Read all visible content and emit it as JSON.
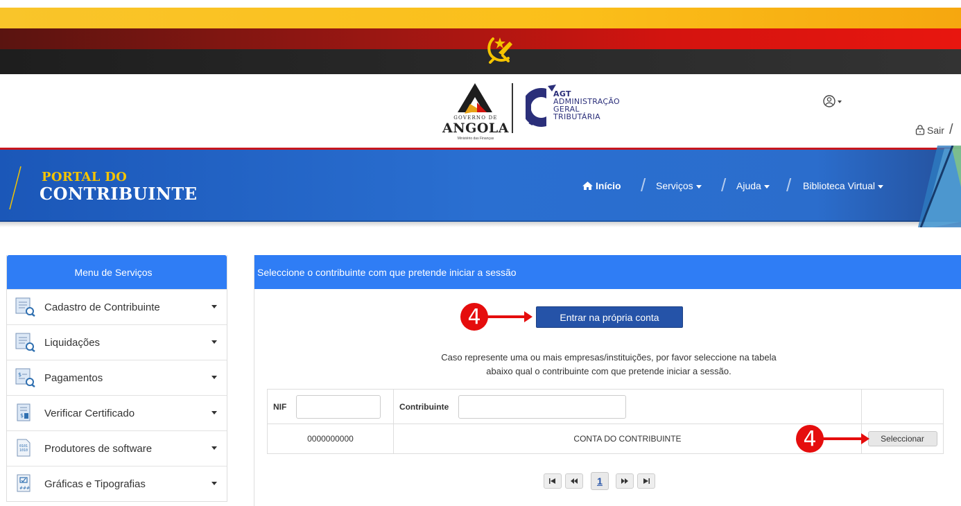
{
  "header": {
    "gov_caption": "GOVERNO DE",
    "gov_name": "ANGOLA",
    "gov_sub": "Ministério das Finanças",
    "agt_abbr": "AGT",
    "agt_line1": "ADMINISTRAÇÃO",
    "agt_line2": "GERAL",
    "agt_line3": "TRIBUTÁRIA",
    "logout_label": "Sair"
  },
  "brand": {
    "line1": "PORTAL DO",
    "line2": "CONTRIBUINTE"
  },
  "nav": {
    "home": "Início",
    "services": "Serviços",
    "help": "Ajuda",
    "library": "Biblioteca Virtual"
  },
  "sidebar": {
    "title": "Menu de Serviços",
    "items": [
      {
        "label": "Cadastro de Contribuinte"
      },
      {
        "label": "Liquidações"
      },
      {
        "label": "Pagamentos"
      },
      {
        "label": "Verificar Certificado"
      },
      {
        "label": "Produtores de software"
      },
      {
        "label": "Gráficas e Tipografias"
      }
    ]
  },
  "main": {
    "title": "Seleccione o contribuinte com que pretende iniciar a sessão",
    "enter_button": "Entrar na própria conta",
    "info_line1": "Caso represente uma ou mais empresas/instituições, por favor seleccione na tabela",
    "info_line2": "abaixo qual o contribuinte com que pretende iniciar a sessão.",
    "table": {
      "col_nif": "NIF",
      "col_contrib": "Contribuinte",
      "rows": [
        {
          "nif": "0000000000",
          "name": "CONTA DO CONTRIBUINTE",
          "action": "Seleccionar"
        }
      ]
    },
    "pager": {
      "first": "⏮",
      "prev": "⏪",
      "page": "1",
      "next": "⏩",
      "last": "⏭"
    }
  },
  "annotations": {
    "marker1": "4",
    "marker2": "4",
    "color": "#e50d0d"
  },
  "colors": {
    "nav_blue": "#2a6fd1",
    "panel_blue": "#2f7df5",
    "button_blue": "#2553a8",
    "brand_gold": "#f5c400"
  }
}
